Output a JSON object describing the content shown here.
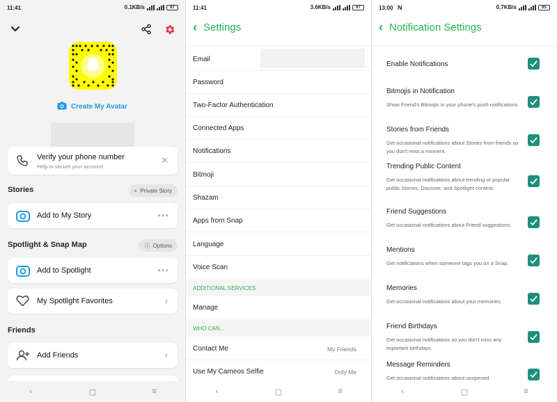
{
  "colors": {
    "accent_green": "#24b44d",
    "accent_blue": "#1f9be0",
    "checkbox": "#1f8f7c",
    "snapcode_yellow": "#fffc00",
    "gear_red": "#e2334a"
  },
  "panel1": {
    "status": {
      "time": "11:41",
      "speed": "0.1KB/s",
      "battery": "67"
    },
    "icons": {
      "collapse": "chevron-down-icon",
      "share": "share-icon",
      "settings": "gear-icon"
    },
    "create_avatar": "Create My Avatar",
    "verify": {
      "title": "Verify your phone number",
      "subtitle": "Help to secure your account!"
    },
    "stories_title": "Stories",
    "private_story": "Private Story",
    "add_to_story": "Add to My Story",
    "spotlight_title": "Spotlight & Snap Map",
    "options": "Options",
    "add_to_spotlight": "Add to Spotlight",
    "spotlight_favorites": "My Spotlight Favorites",
    "friends_title": "Friends",
    "add_friends": "Add Friends"
  },
  "panel2": {
    "status": {
      "time": "11:41",
      "speed": "3.6KB/s",
      "battery": "67"
    },
    "title": "Settings",
    "items": [
      {
        "label": "Email"
      },
      {
        "label": "Password"
      },
      {
        "label": "Two-Factor Authentication"
      },
      {
        "label": "Connected Apps"
      },
      {
        "label": "Notifications"
      },
      {
        "label": "Bitmoji"
      },
      {
        "label": "Shazam"
      },
      {
        "label": "Apps from Snap"
      },
      {
        "label": "Language"
      },
      {
        "label": "Voice Scan"
      }
    ],
    "additional_services": "ADDITIONAL SERVICES",
    "manage": "Manage",
    "who_can": "WHO CAN...",
    "contact_me": {
      "label": "Contact Me",
      "value": "My Friends"
    },
    "cameos": {
      "label": "Use My Cameos Selfie",
      "value": "Only Me"
    }
  },
  "panel3": {
    "status": {
      "time": "13:00",
      "extra": "N",
      "speed": "0.7KB/s",
      "battery": "65"
    },
    "title": "Notification Settings",
    "enable": {
      "label": "Enable Notifications",
      "checked": true
    },
    "items": [
      {
        "title": "Bitmojis in Notification",
        "desc": "Show Friend's Bitmojis in your phone's push notifications.",
        "checked": true
      },
      {
        "title": "Stories from Friends",
        "desc": "Get occasional notifications about Stories from friends so you don't miss a moment.",
        "checked": true
      },
      {
        "title": "Trending Public Content",
        "desc": "Get occasional notifications about trending or popular public Stories, Discover, and Spotlight content.",
        "checked": true
      },
      {
        "title": "Friend Suggestions",
        "desc": "Get occasional notifications about Friend suggestions.",
        "checked": true
      },
      {
        "title": "Mentions",
        "desc": "Get notifications when someone tags you on a Snap.",
        "checked": true
      },
      {
        "title": "Memories",
        "desc": "Get occasional notifications about your memories.",
        "checked": true
      },
      {
        "title": "Friend Birthdays",
        "desc": "Get occasional notifications so you don't miss any important birthdays.",
        "checked": true
      },
      {
        "title": "Message Reminders",
        "desc": "Get occasional notifications about unopened",
        "checked": true
      }
    ]
  },
  "navbar": {
    "back": "‹",
    "home": "▢",
    "menu": "≡"
  }
}
